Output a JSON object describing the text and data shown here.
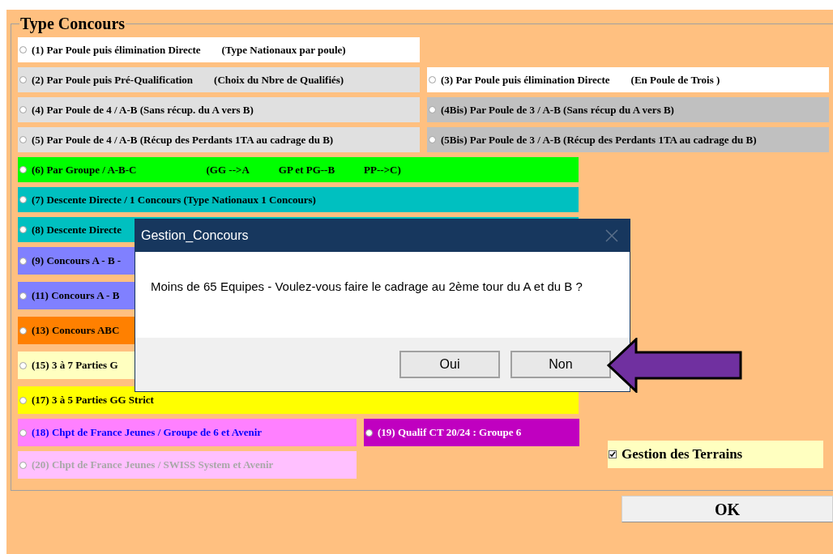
{
  "group": {
    "title": "Type Concours",
    "rows": [
      {
        "options": [
          {
            "parts": [
              "(1) Par Poule puis élimination Directe",
              "(Type Nationaux par poule)"
            ],
            "color": "#ffffff",
            "kind": "plain",
            "selected": false,
            "disabled": false
          }
        ]
      },
      {
        "options": [
          {
            "parts": [
              "(2) Par Poule puis Pré-Qualification",
              "(Choix du Nbre de Qualifiés)"
            ],
            "color": "#e0e0e0",
            "kind": "plain",
            "selected": false,
            "disabled": false
          },
          {
            "parts": [
              "(3) Par Poule puis élimination Directe",
              "(En Poule de Trois )"
            ],
            "color": "#ffffff",
            "kind": "plain",
            "selected": false,
            "disabled": false
          }
        ]
      },
      {
        "options": [
          {
            "parts": [
              "(4) Par Poule de 4  / A-B (Sans récup. du A vers B)"
            ],
            "color": "#e0e0e0",
            "kind": "plain",
            "selected": false,
            "disabled": false
          },
          {
            "parts": [
              "(4Bis) Par Poule de 3 / A-B (Sans récup du A vers B)"
            ],
            "color": "#c0c0c0",
            "kind": "plain",
            "selected": false,
            "disabled": false
          }
        ]
      },
      {
        "options": [
          {
            "parts": [
              "(5) Par Poule de 4 / A-B (Récup des Perdants 1TA au cadrage du B)"
            ],
            "color": "#e0e0e0",
            "kind": "plain",
            "selected": false,
            "disabled": false
          },
          {
            "parts": [
              "(5Bis) Par Poule de 3 / A-B (Récup des Perdants 1TA au cadrage du B)"
            ],
            "color": "#c0c0c0",
            "kind": "plain",
            "selected": false,
            "disabled": false
          }
        ]
      },
      {
        "options": [
          {
            "parts": [
              "(6) Par Groupe / A-B-C",
              "(GG -->A",
              "GP et PG--B",
              "PP-->C)"
            ],
            "color": "#00ff00",
            "kind": "plain",
            "selected": false,
            "disabled": false
          }
        ]
      },
      {
        "options": [
          {
            "parts": [
              "(7) Descente Directe / 1 Concours  (Type Nationaux 1 Concours)"
            ],
            "color": "#00c0c0",
            "kind": "plain",
            "selected": false,
            "disabled": false
          }
        ]
      },
      {
        "options": [
          {
            "parts": [
              "(8) Descente Directe"
            ],
            "color": "#00c0c0",
            "kind": "plain",
            "selected": false,
            "disabled": false
          }
        ]
      },
      {
        "options": [
          {
            "parts": [
              "(9) Concours A - B -"
            ],
            "color": "#8080ff",
            "kind": "plain",
            "selected": false,
            "disabled": false
          }
        ]
      },
      {
        "options": [
          {
            "parts": [
              "(11) Concours A - B"
            ],
            "color": "#8080ff",
            "kind": "plain",
            "selected": false,
            "disabled": false
          }
        ]
      },
      {
        "options": [
          {
            "parts": [
              "(13) Concours ABC"
            ],
            "color": "#ff8000",
            "kind": "plain",
            "selected": false,
            "disabled": false
          }
        ]
      },
      {
        "options": [
          {
            "parts": [
              "(15) 3 à 7 Parties G"
            ],
            "color": "#ffffc0",
            "kind": "plain",
            "selected": false,
            "disabled": false
          }
        ]
      },
      {
        "options": [
          {
            "parts": [
              "(17) 3 à 5 Parties GG Strict"
            ],
            "color": "#ffff00",
            "kind": "plain",
            "selected": false,
            "disabled": false
          }
        ]
      },
      {
        "options": [
          {
            "parts": [
              "(18) Chpt de France Jeunes / Groupe de 6  et Avenir"
            ],
            "color": "#ff80ff",
            "kind": "link",
            "selected": false,
            "disabled": false
          },
          {
            "parts": [
              "(19) Qualif CT 20/24 : Groupe 6"
            ],
            "color": "#c000c0",
            "kind": "inverse",
            "selected": false,
            "disabled": false
          }
        ]
      },
      {
        "options": [
          {
            "parts": [
              "(20) Chpt de France Jeunes / SWISS System  et Avenir"
            ],
            "color": "#ffc0ff",
            "selected": false,
            "disabled": true
          }
        ]
      }
    ],
    "terrain_checkbox": {
      "label": "Gestion des Terrains",
      "checked": true
    }
  },
  "ok_button": "OK",
  "dialog": {
    "title": "Gestion_Concours",
    "message": "Moins de 65 Equipes - Voulez-vous faire le cadrage au 2ème tour du A et du B ?",
    "buttons": [
      "Oui",
      "Non"
    ]
  }
}
